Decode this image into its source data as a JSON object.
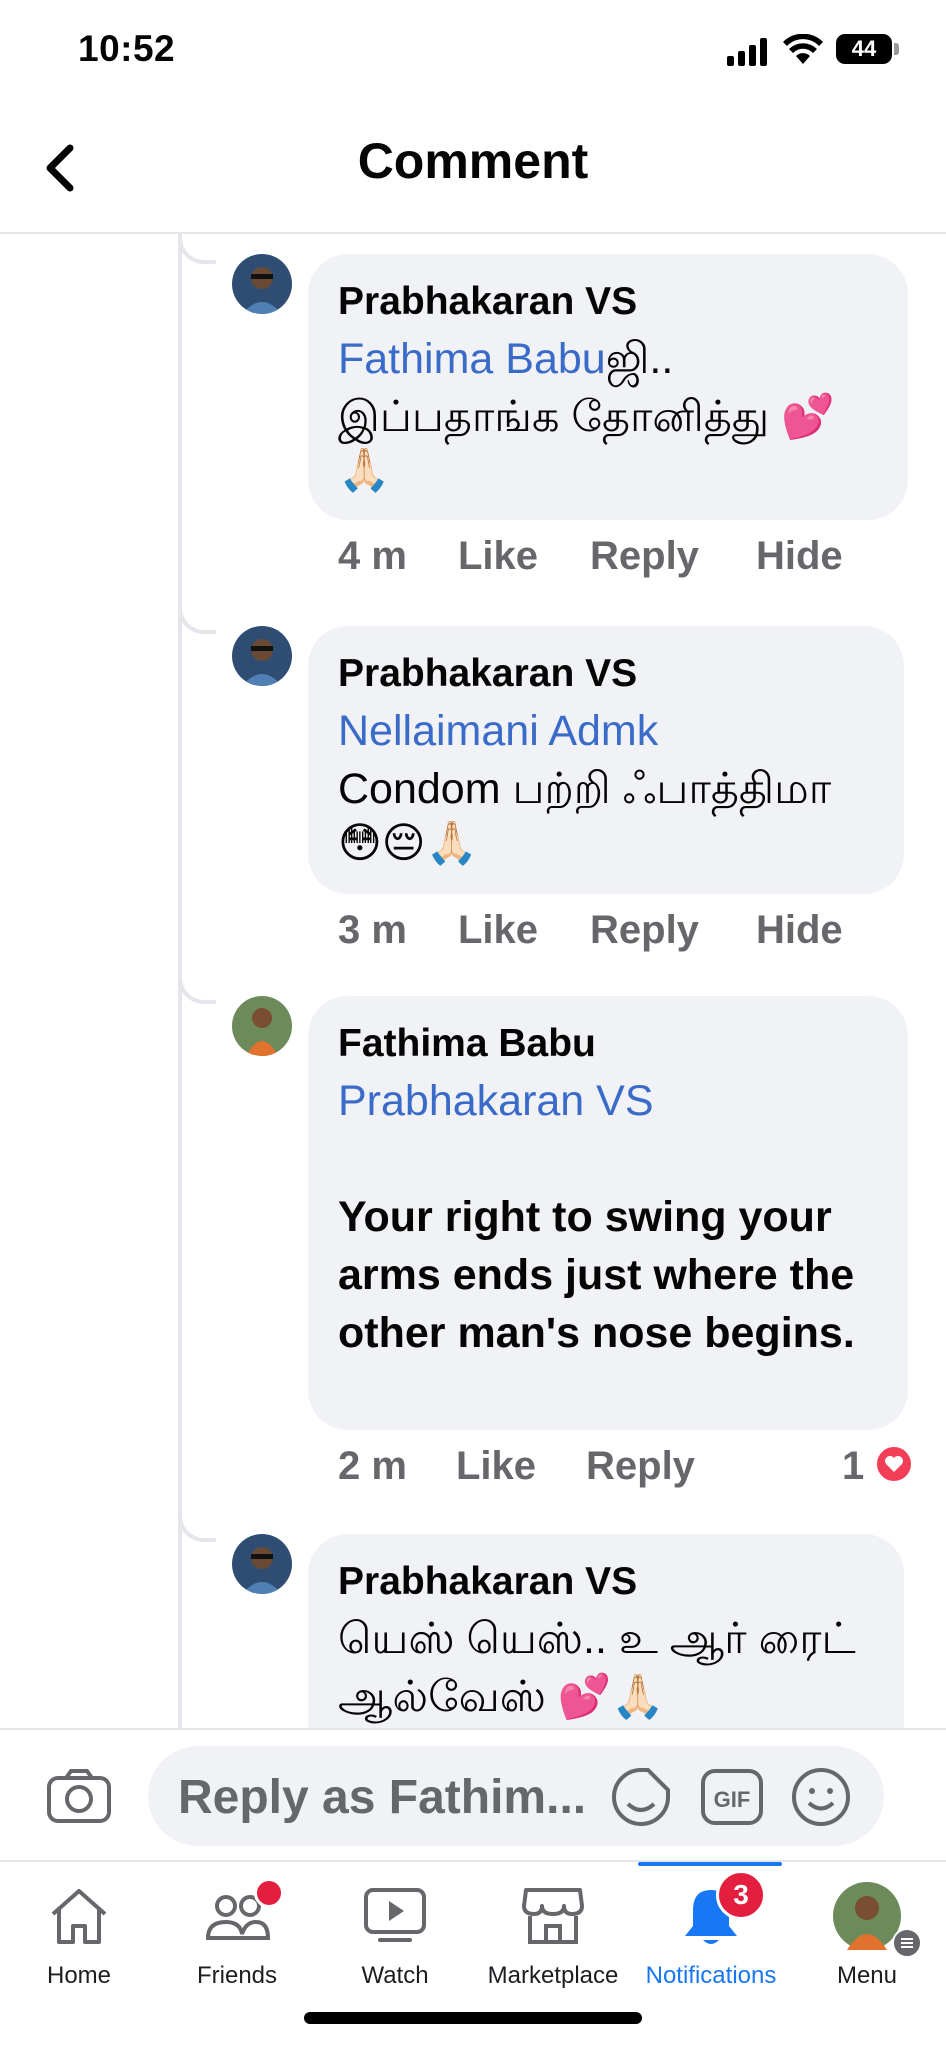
{
  "status_bar": {
    "time": "10:52",
    "battery": "44"
  },
  "header": {
    "title": "Comment"
  },
  "comments": [
    {
      "author": "Prabhakaran VS",
      "mention": "Fathima Babu",
      "mention_suffix": "ஜி..",
      "text": "இப்பதாங்க தோனித்து 💕",
      "emoji_line": "🙏🏻",
      "time": "4 m",
      "actions": [
        "Like",
        "Reply",
        "Hide"
      ]
    },
    {
      "author": "Prabhakaran VS",
      "mention": "Nellaimani Admk",
      "text_en": "Condom",
      "text": " பற்றி ஃபாத்திமா",
      "emoji_line": "😳😔🙏🏻",
      "time": "3 m",
      "actions": [
        "Like",
        "Reply",
        "Hide"
      ]
    },
    {
      "author": "Fathima Babu",
      "mention": "Prabhakaran VS",
      "text": "Your right to swing your arms ends just where the other man's nose begins.",
      "time": "2 m",
      "actions": [
        "Like",
        "Reply"
      ],
      "reaction_count": "1",
      "reaction_type": "love"
    },
    {
      "author": "Prabhakaran VS",
      "text": "யெஸ் யெஸ்.. உ ஆர் ரைட்",
      "text2": "ஆல்வேஸ் 💕🙏🏻"
    }
  ],
  "composer": {
    "placeholder": "Reply as Fathim..."
  },
  "tabs": [
    {
      "label": "Home",
      "icon": "home-icon"
    },
    {
      "label": "Friends",
      "icon": "friends-icon",
      "dot": true
    },
    {
      "label": "Watch",
      "icon": "watch-icon"
    },
    {
      "label": "Marketplace",
      "icon": "marketplace-icon"
    },
    {
      "label": "Notifications",
      "icon": "bell-icon",
      "badge": "3",
      "active": true
    },
    {
      "label": "Menu",
      "icon": "menu-avatar"
    }
  ],
  "colors": {
    "accent": "#1877f2",
    "mention": "#3a6bc8",
    "bubble": "#f0f2f5",
    "badge": "#e41e3f",
    "heart": "#f33e58"
  }
}
